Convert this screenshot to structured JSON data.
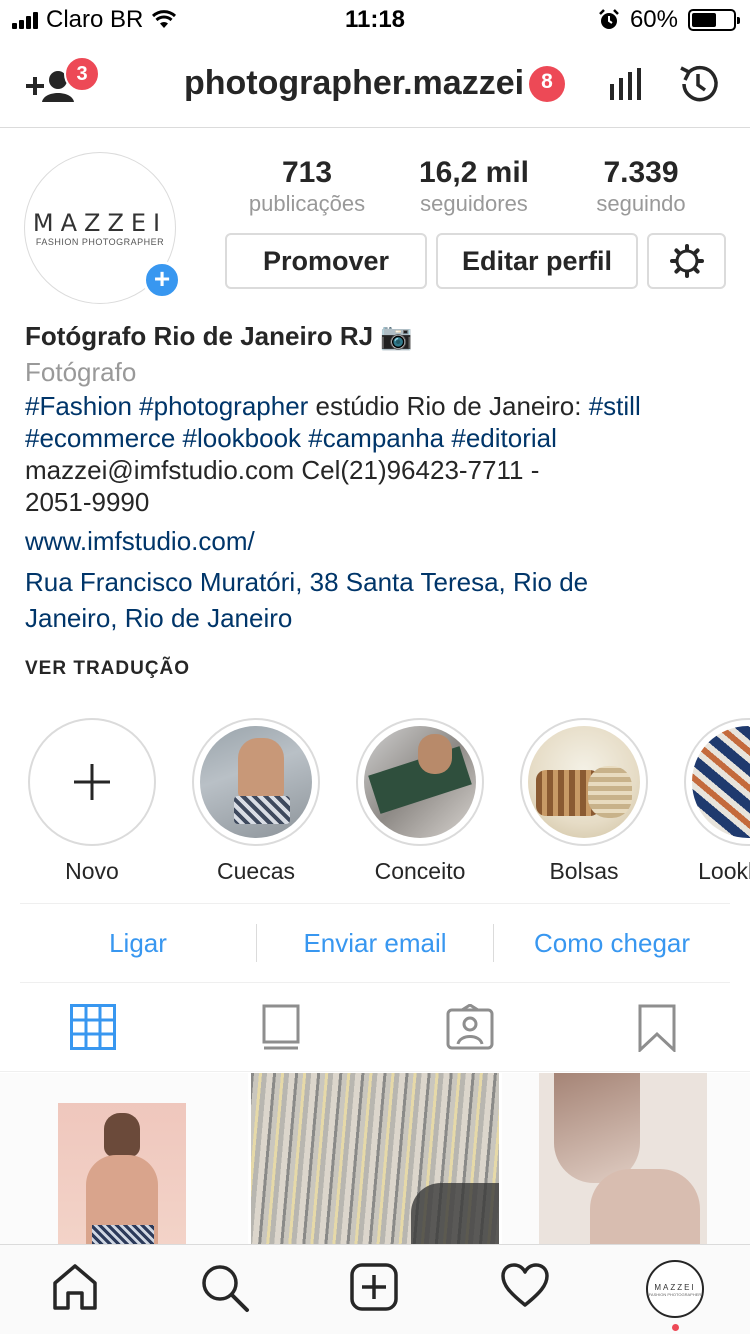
{
  "status_bar": {
    "carrier": "Claro BR",
    "time": "11:18",
    "battery_percent": "60%",
    "battery_level": 0.6
  },
  "header": {
    "notification_count": "3",
    "username": "photographer.mazzei",
    "username_badge": "8"
  },
  "profile": {
    "avatar_logo": "MAZZEI",
    "avatar_subtitle": "FASHION PHOTOGRAPHER",
    "stats": [
      {
        "value": "713",
        "label": "publicações"
      },
      {
        "value": "16,2 mil",
        "label": "seguidores"
      },
      {
        "value": "7.339",
        "label": "seguindo"
      }
    ],
    "buttons": {
      "promote": "Promover",
      "edit": "Editar perfil"
    }
  },
  "bio": {
    "name": "Fotógrafo Rio de Janeiro RJ 📷",
    "category": "Fotógrafo",
    "line1_tags": "#Fashion #photographer",
    "line1_text": " estúdio Rio de Janeiro: ",
    "line1_tag_end": "#still",
    "line2_tags": "#ecommerce #lookbook #campanha #editorial",
    "line3": "mazzei@imfstudio.com Cel(21)96423-7711 -",
    "line4": "2051-9990",
    "website": "www.imfstudio.com/",
    "address_line1": "Rua Francisco Muratóri, 38 Santa Teresa, Rio de",
    "address_line2": "Janeiro, Rio de Janeiro",
    "translate": "VER TRADUÇÃO"
  },
  "highlights": [
    {
      "label": "Novo"
    },
    {
      "label": "Cuecas"
    },
    {
      "label": "Conceito"
    },
    {
      "label": "Bolsas"
    },
    {
      "label": "Lookbook"
    }
  ],
  "contact": {
    "call": "Ligar",
    "email": "Enviar email",
    "directions": "Como chegar"
  },
  "colors": {
    "link_blue": "#3897f0",
    "tag_blue": "#003569",
    "badge_red": "#ed4956"
  }
}
